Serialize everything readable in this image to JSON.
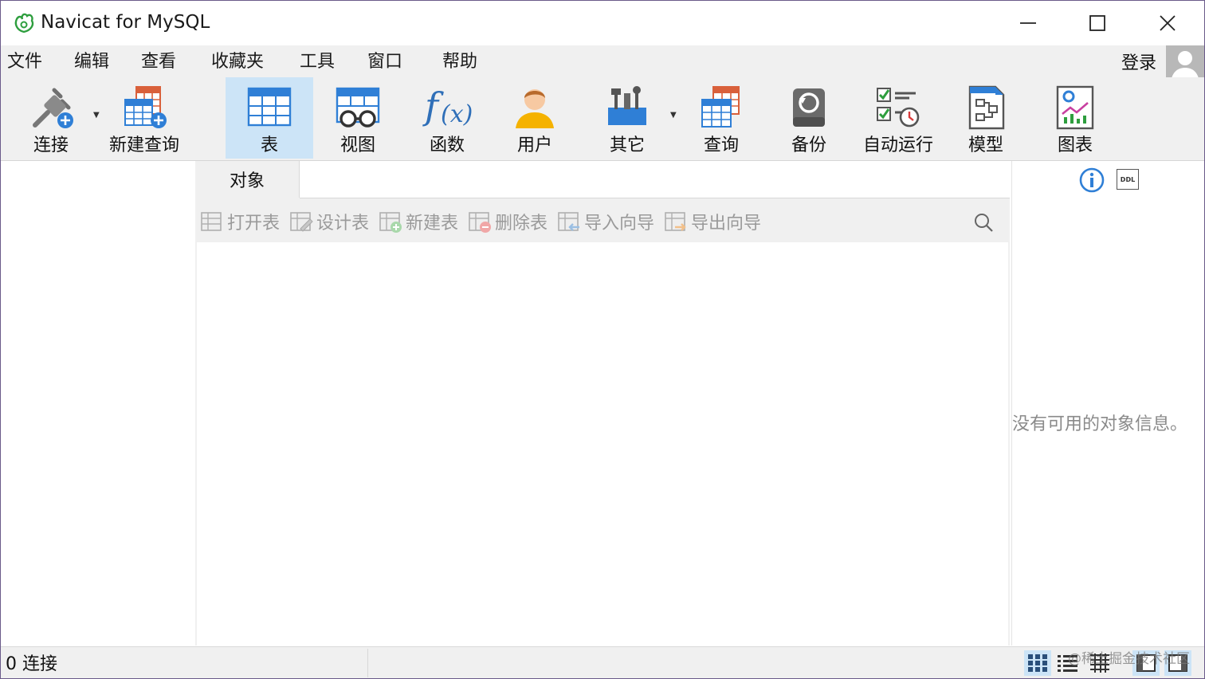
{
  "window": {
    "title": "Navicat for MySQL",
    "controls": {
      "minimize": "minimize-icon",
      "maximize": "maximize-icon",
      "close": "close-icon"
    }
  },
  "menubar": {
    "items": [
      "文件",
      "编辑",
      "查看",
      "收藏夹",
      "工具",
      "窗口",
      "帮助"
    ],
    "login": "登录"
  },
  "toolbar": {
    "buttons": [
      {
        "label": "连接",
        "icon": "plug-add-icon",
        "dropdown": true
      },
      {
        "label": "新建查询",
        "icon": "new-query-icon"
      },
      {
        "label": "表",
        "icon": "table-icon",
        "active": true
      },
      {
        "label": "视图",
        "icon": "view-glasses-icon"
      },
      {
        "label": "函数",
        "icon": "function-icon"
      },
      {
        "label": "用户",
        "icon": "user-icon"
      },
      {
        "label": "其它",
        "icon": "tools-icon",
        "dropdown": true
      },
      {
        "label": "查询",
        "icon": "query-icon"
      },
      {
        "label": "备份",
        "icon": "backup-icon"
      },
      {
        "label": "自动运行",
        "icon": "schedule-icon"
      },
      {
        "label": "模型",
        "icon": "model-icon"
      },
      {
        "label": "图表",
        "icon": "chart-icon"
      }
    ]
  },
  "objects": {
    "tab_label": "对象",
    "actions": [
      {
        "label": "打开表",
        "icon": "open-table-icon"
      },
      {
        "label": "设计表",
        "icon": "design-table-icon"
      },
      {
        "label": "新建表",
        "icon": "new-table-icon"
      },
      {
        "label": "删除表",
        "icon": "delete-table-icon"
      },
      {
        "label": "导入向导",
        "icon": "import-wizard-icon"
      },
      {
        "label": "导出向导",
        "icon": "export-wizard-icon"
      }
    ]
  },
  "info_panel": {
    "empty_message": "没有可用的对象信息。",
    "ddl_label": "DDL"
  },
  "status": {
    "connections": "0 连接",
    "watermark": "@稀土掘金技术社区"
  },
  "colors": {
    "accent": "#cce4f7",
    "brand_green": "#2e9e3e",
    "icon_blue": "#2f7fd6"
  }
}
